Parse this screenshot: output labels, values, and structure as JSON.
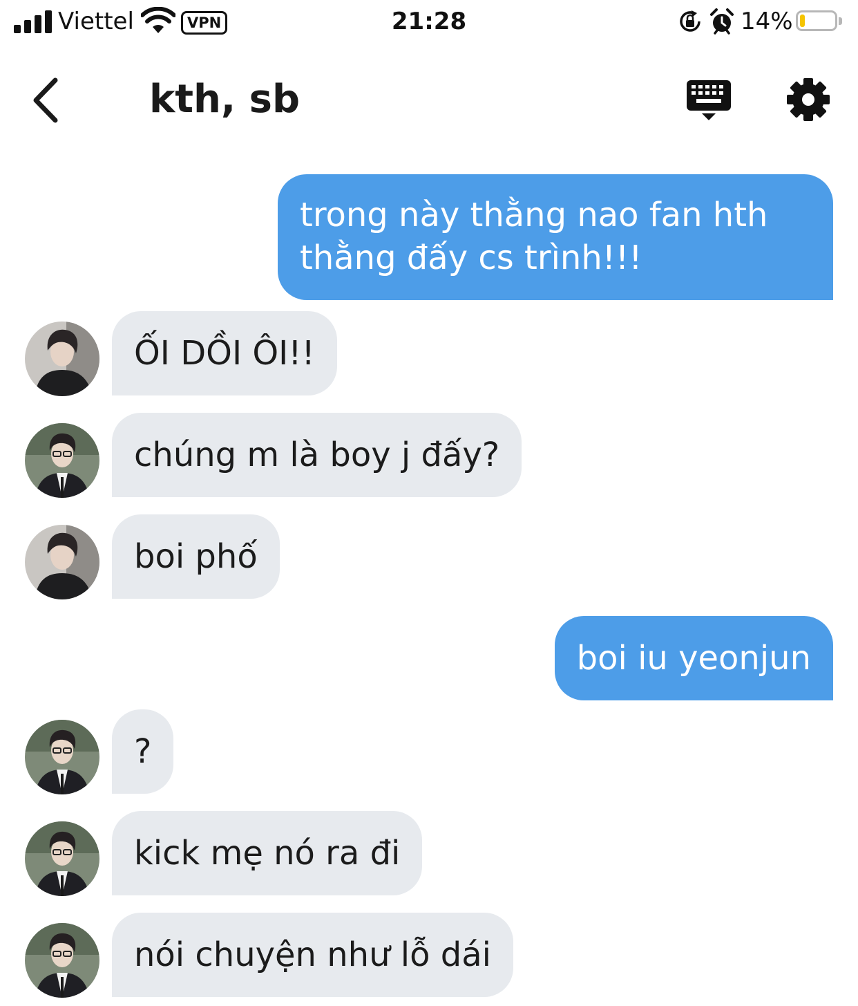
{
  "status_bar": {
    "carrier": "Viettel",
    "vpn_label": "VPN",
    "time": "21:28",
    "battery_percent": "14%",
    "battery_level": 0.14,
    "battery_color": "#f5c400",
    "icons": [
      "signal-icon",
      "wifi-icon",
      "rotation-lock-icon",
      "alarm-icon",
      "battery-icon"
    ]
  },
  "header": {
    "title": "kth, sb",
    "back_icon": "chevron-left-icon",
    "keyboard_icon": "keyboard-icon",
    "settings_icon": "gear-icon"
  },
  "colors": {
    "outgoing_bubble": "#4d9de8",
    "incoming_bubble": "#e7eaee"
  },
  "messages": [
    {
      "direction": "out",
      "lines": [
        "trong này thằng nao fan hth",
        "thằng đấy cs trình!!!"
      ]
    },
    {
      "direction": "in",
      "sender_avatar": "avatar-a",
      "text": "ỐI DỒI ÔI!!"
    },
    {
      "direction": "in",
      "sender_avatar": "avatar-b",
      "text": "chúng m là boy j đấy?"
    },
    {
      "direction": "in",
      "sender_avatar": "avatar-a",
      "text": "boi phố"
    },
    {
      "direction": "out",
      "text": "boi iu yeonjun"
    },
    {
      "direction": "in",
      "sender_avatar": "avatar-b",
      "text": "?"
    },
    {
      "direction": "in",
      "sender_avatar": "avatar-b",
      "text": "kick mẹ nó ra đi"
    },
    {
      "direction": "in",
      "sender_avatar": "avatar-b",
      "text": "nói chuyện như lỗ dái"
    }
  ]
}
